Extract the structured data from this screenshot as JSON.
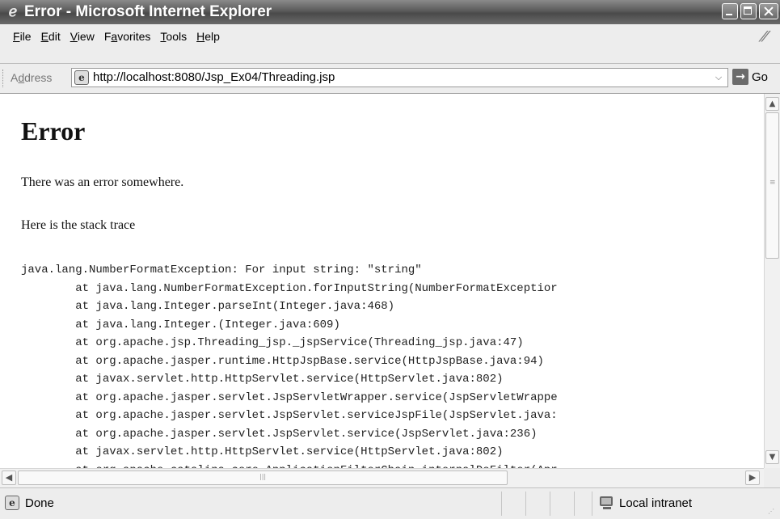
{
  "window": {
    "title": "Error - Microsoft Internet Explorer"
  },
  "menu": {
    "items": [
      {
        "accel": "F",
        "rest": "ile"
      },
      {
        "accel": "E",
        "rest": "dit"
      },
      {
        "accel": "V",
        "rest": "iew"
      },
      {
        "pre": "F",
        "accel": "a",
        "rest": "vorites"
      },
      {
        "accel": "T",
        "rest": "ools"
      },
      {
        "accel": "H",
        "rest": "elp"
      }
    ]
  },
  "address": {
    "label_pre": "A",
    "label_accel": "d",
    "label_rest": "dress",
    "url": "http://localhost:8080/Jsp_Ex04/Threading.jsp",
    "go_label": "Go"
  },
  "content": {
    "heading": "Error",
    "message": "There was an error somewhere.",
    "stack_intro": "Here is the stack trace",
    "stack_trace": "java.lang.NumberFormatException: For input string: \"string\"\n        at java.lang.NumberFormatException.forInputString(NumberFormatExceptior\n        at java.lang.Integer.parseInt(Integer.java:468)\n        at java.lang.Integer.(Integer.java:609)\n        at org.apache.jsp.Threading_jsp._jspService(Threading_jsp.java:47)\n        at org.apache.jasper.runtime.HttpJspBase.service(HttpJspBase.java:94)\n        at javax.servlet.http.HttpServlet.service(HttpServlet.java:802)\n        at org.apache.jasper.servlet.JspServletWrapper.service(JspServletWrappe\n        at org.apache.jasper.servlet.JspServlet.serviceJspFile(JspServlet.java:\n        at org.apache.jasper.servlet.JspServlet.service(JspServlet.java:236)\n        at javax.servlet.http.HttpServlet.service(HttpServlet.java:802)\n        at org.apache.catalina.core.ApplicationFilterChain.internalDoFilter(Apr"
  },
  "status": {
    "text": "Done",
    "zone": "Local intranet"
  },
  "icons": {
    "title": "ie-logo-icon",
    "address": "page-icon",
    "go": "go-arrow-icon",
    "status": "page-icon",
    "zone": "local-intranet-icon"
  }
}
